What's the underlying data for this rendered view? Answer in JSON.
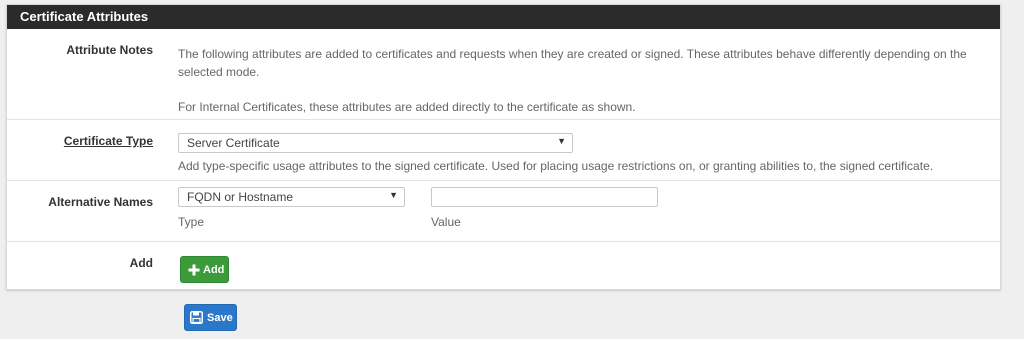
{
  "panel": {
    "title": "Certificate Attributes"
  },
  "attribute_notes": {
    "label": "Attribute Notes",
    "text1": "The following attributes are added to certificates and requests when they are created or signed. These attributes behave differently depending on the selected mode.",
    "text2": "For Internal Certificates, these attributes are added directly to the certificate as shown."
  },
  "certificate_type": {
    "label": "Certificate Type",
    "selected": "Server Certificate",
    "help": "Add type-specific usage attributes to the signed certificate. Used for placing usage restrictions on, or granting abilities to, the signed certificate."
  },
  "alternative_names": {
    "label": "Alternative Names",
    "type_selected": "FQDN or Hostname",
    "type_caption": "Type",
    "value": "",
    "value_caption": "Value"
  },
  "add": {
    "label": "Add",
    "button_label": "Add",
    "icon": "plus-icon"
  },
  "save": {
    "button_label": "Save",
    "icon": "save-icon"
  },
  "colors": {
    "header": "#2b2b2b",
    "add_button": "#3b9b3b",
    "save_button": "#2b77c9"
  }
}
